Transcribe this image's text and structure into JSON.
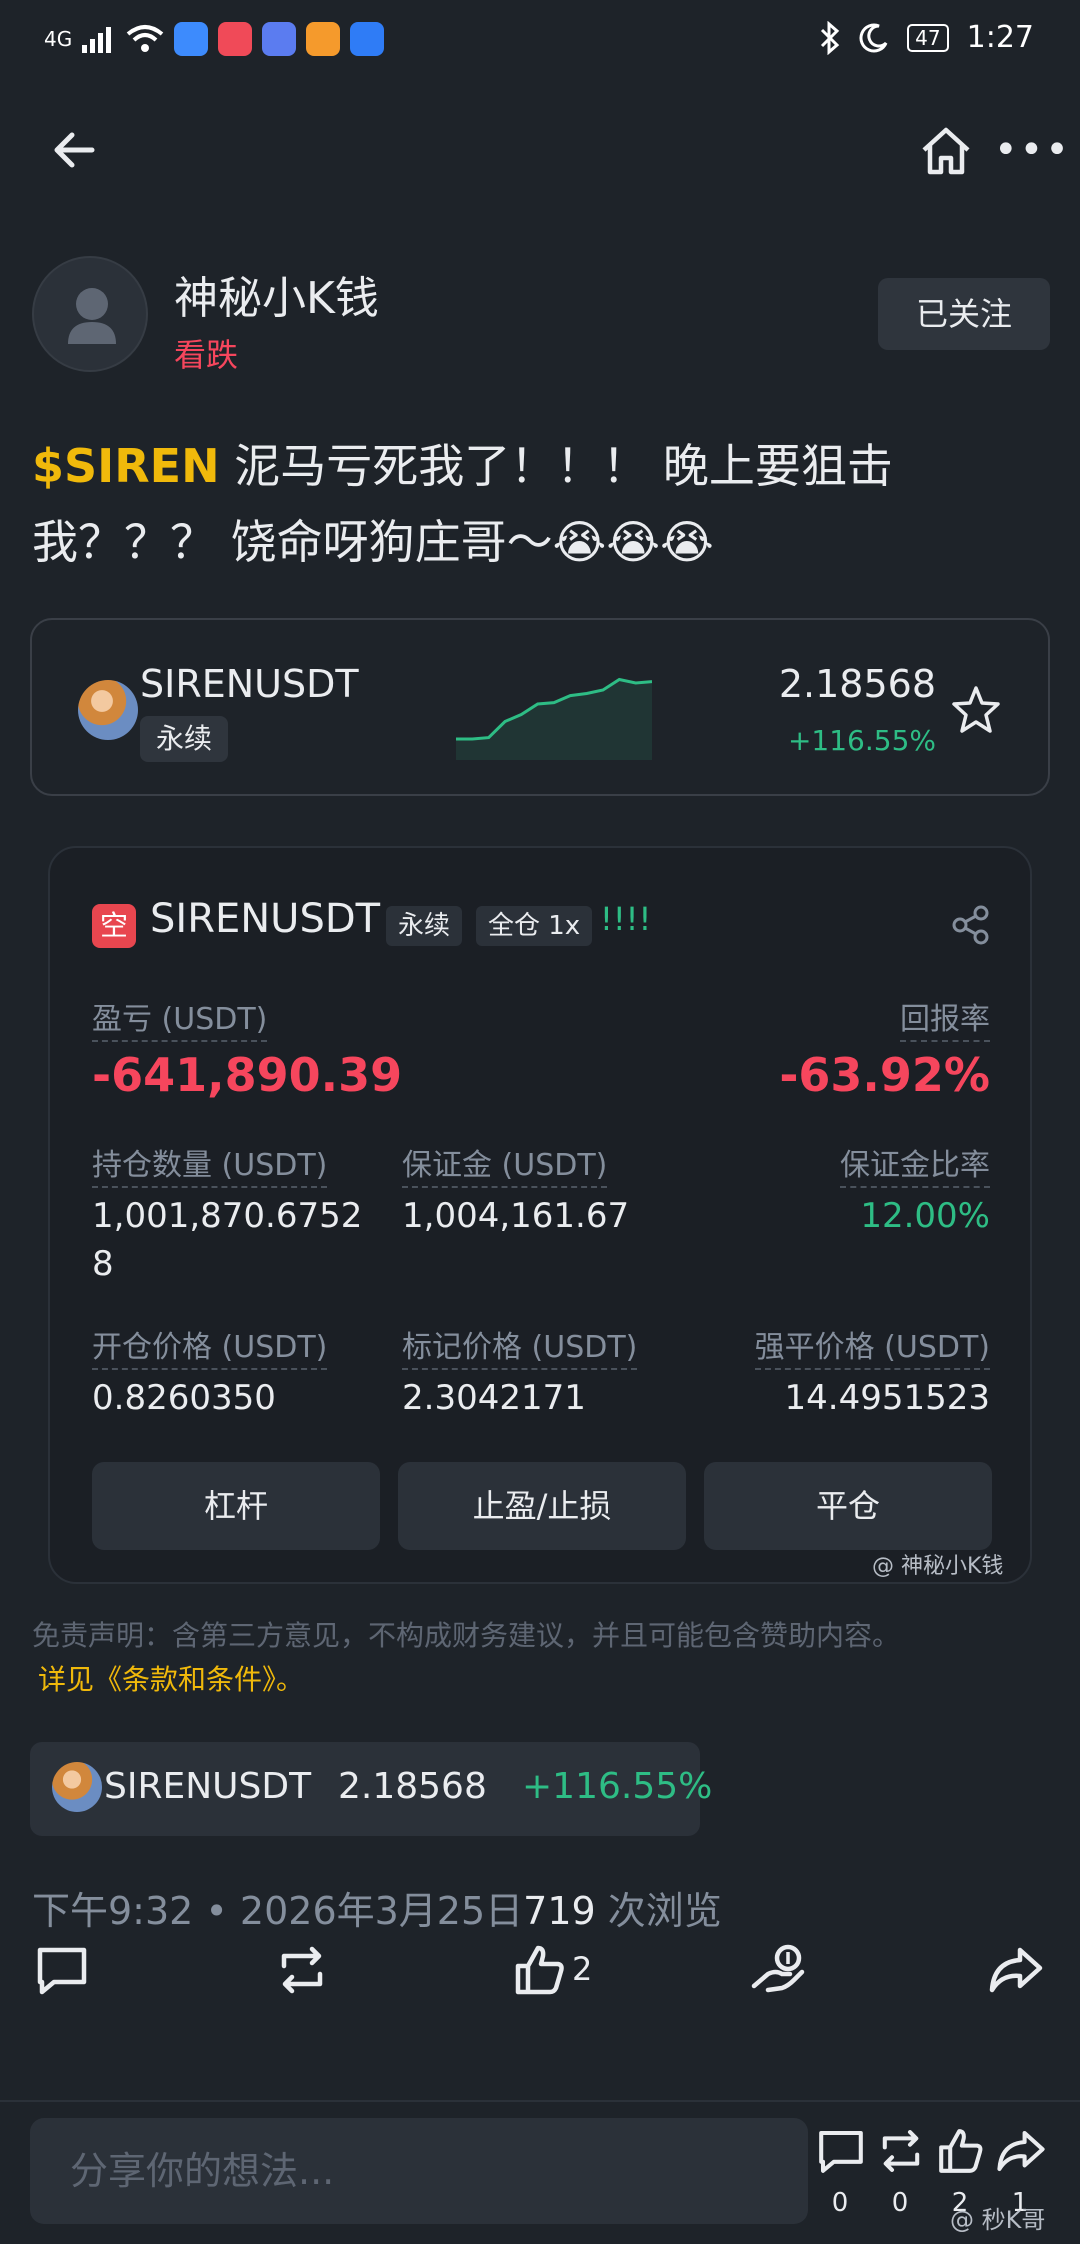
{
  "status_bar": {
    "signal": "4G",
    "time": "1:27",
    "battery": "47"
  },
  "author": {
    "name": "神秘小K钱",
    "tag": "看跌",
    "follow_label": "已关注"
  },
  "post": {
    "ticker": "$SIREN",
    "text": " 泥马亏死我了！！！ 晚上要狙击我？？？ 饶命呀狗庄哥～😭😭😭"
  },
  "market_card": {
    "symbol": "SIRENUSDT",
    "tag": "永续",
    "price": "2.18568",
    "change": "+116.55%",
    "sparkline": [
      0.1,
      0.1,
      0.12,
      0.35,
      0.45,
      0.6,
      0.62,
      0.72,
      0.75,
      0.8,
      0.95,
      0.9,
      0.92
    ]
  },
  "position": {
    "side": "空",
    "symbol": "SIRENUSDT",
    "chip_type": "永续",
    "chip_margin": "全仓 1x",
    "marks": "!!!!",
    "pnl_label": "盈亏 (USDT)",
    "pnl_value": "-641,890.39",
    "roi_label": "回报率",
    "roi_value": "-63.92%",
    "size_label": "持仓数量 (USDT)",
    "size_value_line1": "1,001,870.6752",
    "size_value_line2": "8",
    "margin_label": "保证金 (USDT)",
    "margin_value": "1,004,161.67",
    "margin_ratio_label": "保证金比率",
    "margin_ratio_value": "12.00%",
    "entry_label": "开仓价格 (USDT)",
    "entry_value": "0.8260350",
    "mark_label": "标记价格 (USDT)",
    "mark_value": "2.3042171",
    "liq_label": "强平价格 (USDT)",
    "liq_value": "14.4951523",
    "btn_leverage": "杠杆",
    "btn_tpsl": "止盈/止损",
    "btn_close": "平仓",
    "watermark": "@ 神秘小K钱"
  },
  "disclaimer": {
    "text": "免责声明：含第三方意见，不构成财务建议，并且可能包含赞助内容。",
    "link": "详见《条款和条件》。"
  },
  "ticker_chip": {
    "symbol": "SIRENUSDT",
    "price": "2.18568",
    "change": "+116.55%"
  },
  "meta": {
    "time": "下午9:32",
    "date": "2026年3月25日",
    "views": "719",
    "views_suffix": " 次浏览"
  },
  "actions": {
    "like_count": "2"
  },
  "bottom": {
    "placeholder": "分享你的想法...",
    "comment_count": "0",
    "repost_count": "0",
    "like_count": "2",
    "share_count": "1",
    "watermark": "@ 秒K哥"
  },
  "colors": {
    "background": "#1e2329",
    "positive": "#2ebd85",
    "negative": "#f6465d",
    "accent": "#f0b90b"
  }
}
